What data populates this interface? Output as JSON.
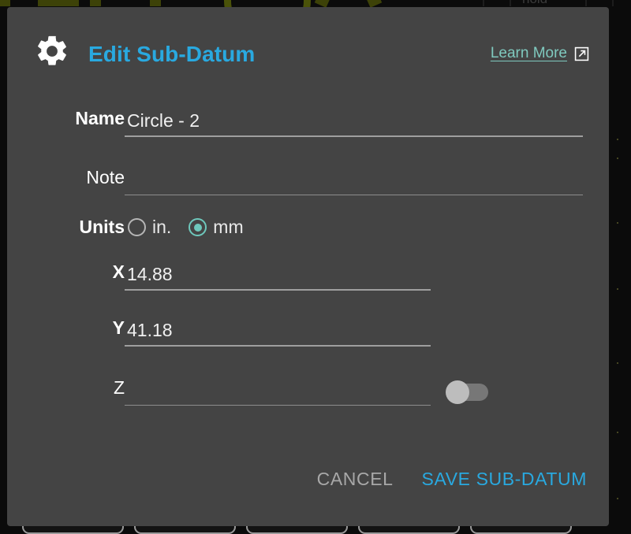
{
  "dialog": {
    "title": "Edit Sub-Datum",
    "gear_icon": "gear-icon",
    "learn_more": {
      "label": "Learn More",
      "icon": "external-link-icon"
    },
    "fields": {
      "name": {
        "label": "Name",
        "value": "Circle - 2",
        "placeholder": ""
      },
      "note": {
        "label": "Note",
        "value": "",
        "placeholder": ""
      },
      "units": {
        "label": "Units",
        "selected": "mm",
        "options": [
          {
            "id": "in",
            "label": "in.",
            "selected": false
          },
          {
            "id": "mm",
            "label": "mm",
            "selected": true
          }
        ]
      },
      "x": {
        "label": "X",
        "value": "14.88",
        "placeholder": ""
      },
      "y": {
        "label": "Y",
        "value": "41.18",
        "placeholder": ""
      },
      "z": {
        "label": "Z",
        "value": "",
        "placeholder": "",
        "toggle_state": "off"
      }
    },
    "footer": {
      "cancel_label": "CANCEL",
      "save_label": "SAVE SUB-DATUM"
    }
  },
  "background": {
    "hint_text": "hold",
    "toolbar_chip_count": 5
  },
  "colors": {
    "dialog_background": "#444444",
    "title_accent": "#29A9E0",
    "link_accent": "#7FC9BE",
    "radio_selected": "#6EC8BC",
    "save_accent": "#29A9E0",
    "cancel_text": "#a8a8a8",
    "field_underline": "#9f9f9f",
    "app_background": "#0b0b0b",
    "olive_shape": "#3d4208"
  }
}
